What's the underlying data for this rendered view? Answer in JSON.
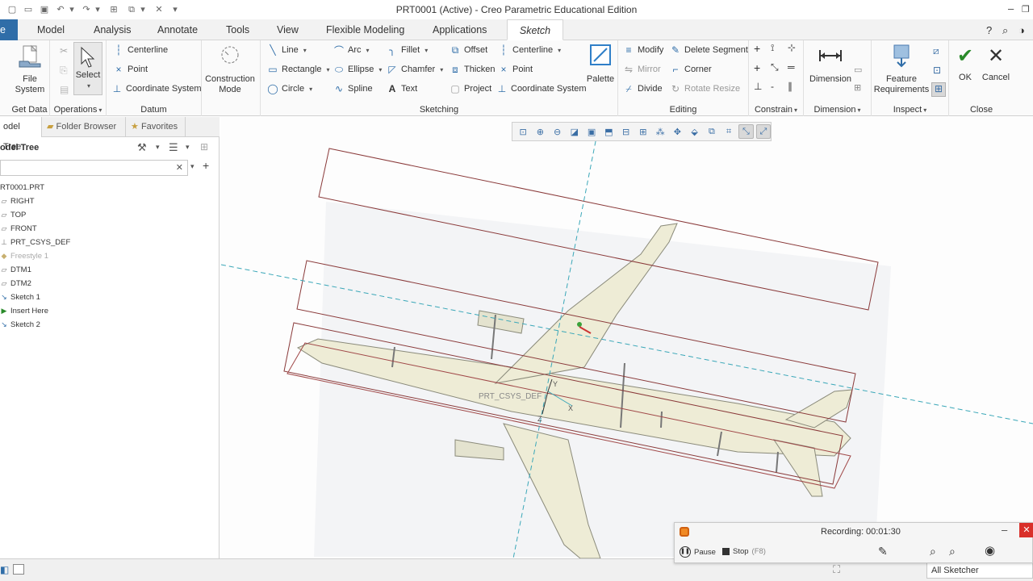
{
  "window": {
    "title": "PRT0001 (Active) - Creo Parametric Educational Edition",
    "minimize_icon": "minimize-icon",
    "restore_icon": "restore-icon"
  },
  "tabs": [
    {
      "label": "e"
    },
    {
      "label": "Model"
    },
    {
      "label": "Analysis"
    },
    {
      "label": "Annotate"
    },
    {
      "label": "Tools"
    },
    {
      "label": "View"
    },
    {
      "label": "Flexible Modeling"
    },
    {
      "label": "Applications"
    },
    {
      "label": "Sketch"
    }
  ],
  "ribbon": {
    "get_data": {
      "label": "Get Data",
      "file_system": "File\nSystem"
    },
    "operations": {
      "label": "Operations",
      "select": "Select"
    },
    "datum": {
      "label": "Datum",
      "centerline": "Centerline",
      "point": "Point",
      "coordinate_system": "Coordinate System"
    },
    "construction_mode": "Construction\nMode",
    "sketching": {
      "label": "Sketching",
      "line": "Line",
      "rectangle": "Rectangle",
      "circle": "Circle",
      "arc": "Arc",
      "ellipse": "Ellipse",
      "spline": "Spline",
      "fillet": "Fillet",
      "chamfer": "Chamfer",
      "text": "Text",
      "offset": "Offset",
      "thicken": "Thicken",
      "project": "Project",
      "centerline": "Centerline",
      "point": "Point",
      "coordinate_system": "Coordinate System",
      "palette": "Palette"
    },
    "editing": {
      "label": "Editing",
      "modify": "Modify",
      "mirror": "Mirror",
      "divide": "Divide",
      "delete_segment": "Delete Segment",
      "corner": "Corner",
      "rotate_resize": "Rotate Resize"
    },
    "constrain": {
      "label": "Constrain"
    },
    "dimension": {
      "label": "Dimension",
      "dimension": "Dimension"
    },
    "inspect": {
      "label": "Inspect",
      "feature_requirements": "Feature\nRequirements"
    },
    "close": {
      "label": "Close",
      "ok": "OK",
      "cancel": "Cancel"
    }
  },
  "panel": {
    "tabs": {
      "model_tree": "odel Tree",
      "folder_browser": "Folder Browser",
      "favorites": "Favorites"
    },
    "header": "odel Tree",
    "search_value": "",
    "items": [
      {
        "label": "RT0001.PRT",
        "icon": "part-icon"
      },
      {
        "label": "RIGHT",
        "icon": "datum-plane-icon"
      },
      {
        "label": "TOP",
        "icon": "datum-plane-icon"
      },
      {
        "label": "FRONT",
        "icon": "datum-plane-icon"
      },
      {
        "label": "PRT_CSYS_DEF",
        "icon": "csys-icon"
      },
      {
        "label": "Freestyle 1",
        "icon": "freestyle-icon"
      },
      {
        "label": "DTM1",
        "icon": "datum-plane-icon"
      },
      {
        "label": "DTM2",
        "icon": "datum-plane-icon"
      },
      {
        "label": "Sketch 1",
        "icon": "sketch-icon"
      },
      {
        "label": "Insert Here",
        "icon": "insert-arrow-icon"
      },
      {
        "label": "Sketch 2",
        "icon": "sketch-icon"
      }
    ]
  },
  "canvas": {
    "csys_label": "PRT_CSYS_DEF",
    "axis_y": "Y",
    "axis_z": "Z",
    "axis_x": "X"
  },
  "recording": {
    "status": "Recording:",
    "time": "00:01:30",
    "pause": "Pause",
    "stop": "Stop",
    "stop_shortcut": "(F8)"
  },
  "statusbar": {
    "filter": "All Sketcher"
  },
  "colors": {
    "accent_blue": "#2f6da8",
    "ok_green": "#2a8a2a",
    "sketch_line": "#8a3a3a",
    "centerline": "#3aa7b8"
  }
}
